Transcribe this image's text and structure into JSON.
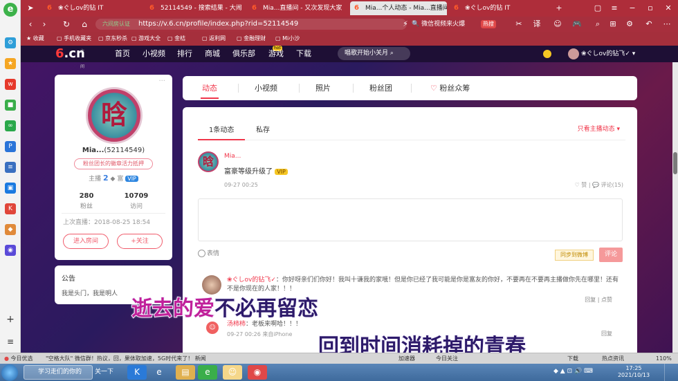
{
  "browser": {
    "tabs": [
      {
        "label": "❀ぐしov的钻 IT"
      },
      {
        "label": "52114549 - 搜索结果 - 大闹"
      },
      {
        "label": "Mia...直播间 - 又次发现大家"
      },
      {
        "label": "Mia...个人动态 - Mia...直播间"
      },
      {
        "label": "❀ぐしov的钻 IT"
      }
    ],
    "url": "https://v.6.cn/profile/index.php?rid=52114549",
    "url_security": "六间房认证",
    "search_placeholder": "微信视频来火爆",
    "search_tag": "热搜",
    "bookmarks": [
      "收藏",
      "手机收藏夹",
      "京东秒杀",
      "游戏大全",
      "金桔",
      "返利网",
      "金融理财",
      "Mi小沙"
    ]
  },
  "site": {
    "logo_num": "6",
    "logo_text": ".cn",
    "logo_small": "六间房",
    "nav": [
      "首页",
      "小视频",
      "排行",
      "商城",
      "俱乐部",
      "游戏",
      "下载"
    ],
    "hot_badge": "hot",
    "search_placeholder": "唱歌开始小关月",
    "user_name": "❀ぐしov的钻飞✓"
  },
  "profile": {
    "avatar_char": "晗",
    "name": "Mia...",
    "id": "(52114549)",
    "tag": "粉丝团长的徽章活力抵押",
    "level_prefix": "主播",
    "level": "2",
    "vip_prefix": "富",
    "vip": "VIP",
    "stats": [
      {
        "num": "280",
        "label": "粉丝"
      },
      {
        "num": "10709",
        "label": "访问"
      }
    ],
    "last_live": "上次直播：2018-08-25 18:54",
    "btn_enter": "进入房间",
    "btn_follow": "+关注"
  },
  "notice": {
    "title": "公告",
    "body": "我是头门，我是明人"
  },
  "page_tabs": [
    "动态",
    "小视频",
    "照片",
    "粉丝团",
    "粉丝众筹"
  ],
  "feed": {
    "sub_tabs": [
      "1条动态",
      "私存"
    ],
    "filter": "只看主播动态 ▾",
    "post": {
      "avatar_char": "晗",
      "user": "Mia...",
      "text": "富豪等级升级了",
      "vip": "VIP",
      "time": "09-27 00:25",
      "actions": "♡ 赞 | 💬 评论(15)"
    },
    "emoji_label": "表情",
    "sync_label": "同步到微博",
    "comment_btn": "评论",
    "comment1": {
      "user": "❀ぐしov的钻飞✓",
      "text": "你好呀亲们们你好！我叫十谦我的家哦！但是你已经了我可能是你是富友的你好，不要再在不要再主播做你先在哪里！还有不是你现在的人家！！！",
      "actions": "回复 | 点赞"
    },
    "comment2": {
      "user": "汤柿柿",
      "text": "老板来啊哈！！！",
      "time": "09-27 00:26",
      "source": "来自iPhone",
      "actions": "回复"
    }
  },
  "lyrics": {
    "line1_a": "逝去的爱",
    "line1_b": "不必再留恋",
    "line2": "回到时间消耗掉的青春"
  },
  "statusbar": {
    "left": "今日优选",
    "news": "\"空格大队\" 微信群！热议，回，果体取加速，5G时代来了！ 新闻",
    "right_items": [
      "加速器",
      "今日关注",
      "下载",
      "热点资讯"
    ],
    "zoom": "110%"
  },
  "taskbar": {
    "item1": "学习走们的你的",
    "item2": "关一下",
    "time": "17:25",
    "date": "2021/10/13"
  }
}
